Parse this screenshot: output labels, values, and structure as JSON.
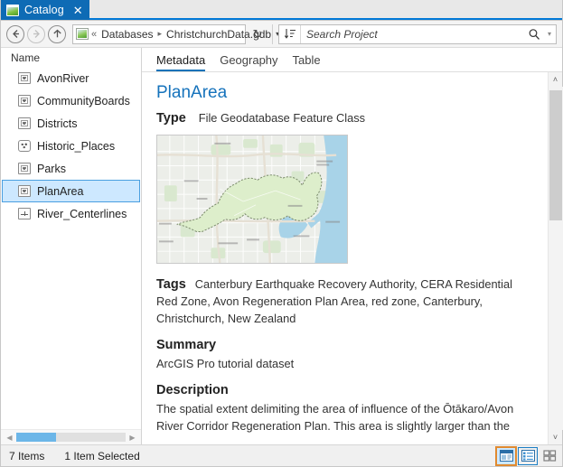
{
  "window": {
    "tab_title": "Catalog",
    "tab_close_glyph": "✕",
    "tab_icon": "catalog-icon"
  },
  "navbar": {
    "back_icon": "back-arrow-icon",
    "forward_icon": "forward-arrow-icon",
    "up_icon": "up-arrow-icon",
    "project_icon": "geodatabase-icon",
    "overflow_glyph": "«",
    "breadcrumb": [
      "Databases",
      "ChristchurchData.gdb"
    ],
    "breadcrumb_sep": "▸",
    "dropdown_glyph": "▾",
    "refresh_glyph": "↻",
    "sort_icon": "sort-descending-icon",
    "search_placeholder": "Search Project",
    "search_value": "",
    "search_icon": "magnifier-icon",
    "search_dropdown_glyph": "▾"
  },
  "tree": {
    "column_header": "Name",
    "items": [
      {
        "label": "AvonRiver",
        "icon": "polygon-feature-class-icon",
        "geom": "poly",
        "selected": false
      },
      {
        "label": "CommunityBoards",
        "icon": "polygon-feature-class-icon",
        "geom": "poly",
        "selected": false
      },
      {
        "label": "Districts",
        "icon": "polygon-feature-class-icon",
        "geom": "poly",
        "selected": false
      },
      {
        "label": "Historic_Places",
        "icon": "point-feature-class-icon",
        "geom": "point",
        "selected": false
      },
      {
        "label": "Parks",
        "icon": "polygon-feature-class-icon",
        "geom": "poly",
        "selected": false
      },
      {
        "label": "PlanArea",
        "icon": "polygon-feature-class-icon",
        "geom": "poly",
        "selected": true
      },
      {
        "label": "River_Centerlines",
        "icon": "line-feature-class-icon",
        "geom": "line",
        "selected": false
      }
    ],
    "hscroll_left_glyph": "◀",
    "hscroll_right_glyph": "▶",
    "hscroll_thumb_pct": 36
  },
  "metadata": {
    "tabs": [
      {
        "label": "Metadata",
        "active": true
      },
      {
        "label": "Geography",
        "active": false
      },
      {
        "label": "Table",
        "active": false
      }
    ],
    "title": "PlanArea",
    "type_label": "Type",
    "type_value": "File Geodatabase Feature Class",
    "thumbnail_alt": "map-thumbnail",
    "tags_label": "Tags",
    "tags_value": "Canterbury Earthquake Recovery Authority, CERA Residential Red Zone, Avon Regeneration Plan Area, red zone, Canterbury, Christchurch, New Zealand",
    "summary_label": "Summary",
    "summary_value": "ArcGIS Pro tutorial dataset",
    "description_label": "Description",
    "description_value": "The spatial extent delimiting the area of influence of the Ōtākaro/Avon River Corridor Regeneration Plan. This area is slightly larger than the",
    "scroll_up_glyph": "˄",
    "scroll_down_glyph": "˅"
  },
  "statusbar": {
    "item_count": "7 Items",
    "selection": "1 Item Selected",
    "view_buttons": [
      {
        "name": "details-view-button",
        "state": "hover-selected"
      },
      {
        "name": "list-view-button",
        "state": "active"
      },
      {
        "name": "tiles-view-button",
        "state": "normal"
      }
    ]
  },
  "colors": {
    "accent_blue": "#0078d7",
    "tab_blue": "#0e6bb5",
    "title_link": "#1673bc",
    "selection_fill": "#cde8ff",
    "selection_border": "#4a9fe0",
    "hover_orange": "#e08a30",
    "scroll_thumb": "#6cb6e8"
  }
}
